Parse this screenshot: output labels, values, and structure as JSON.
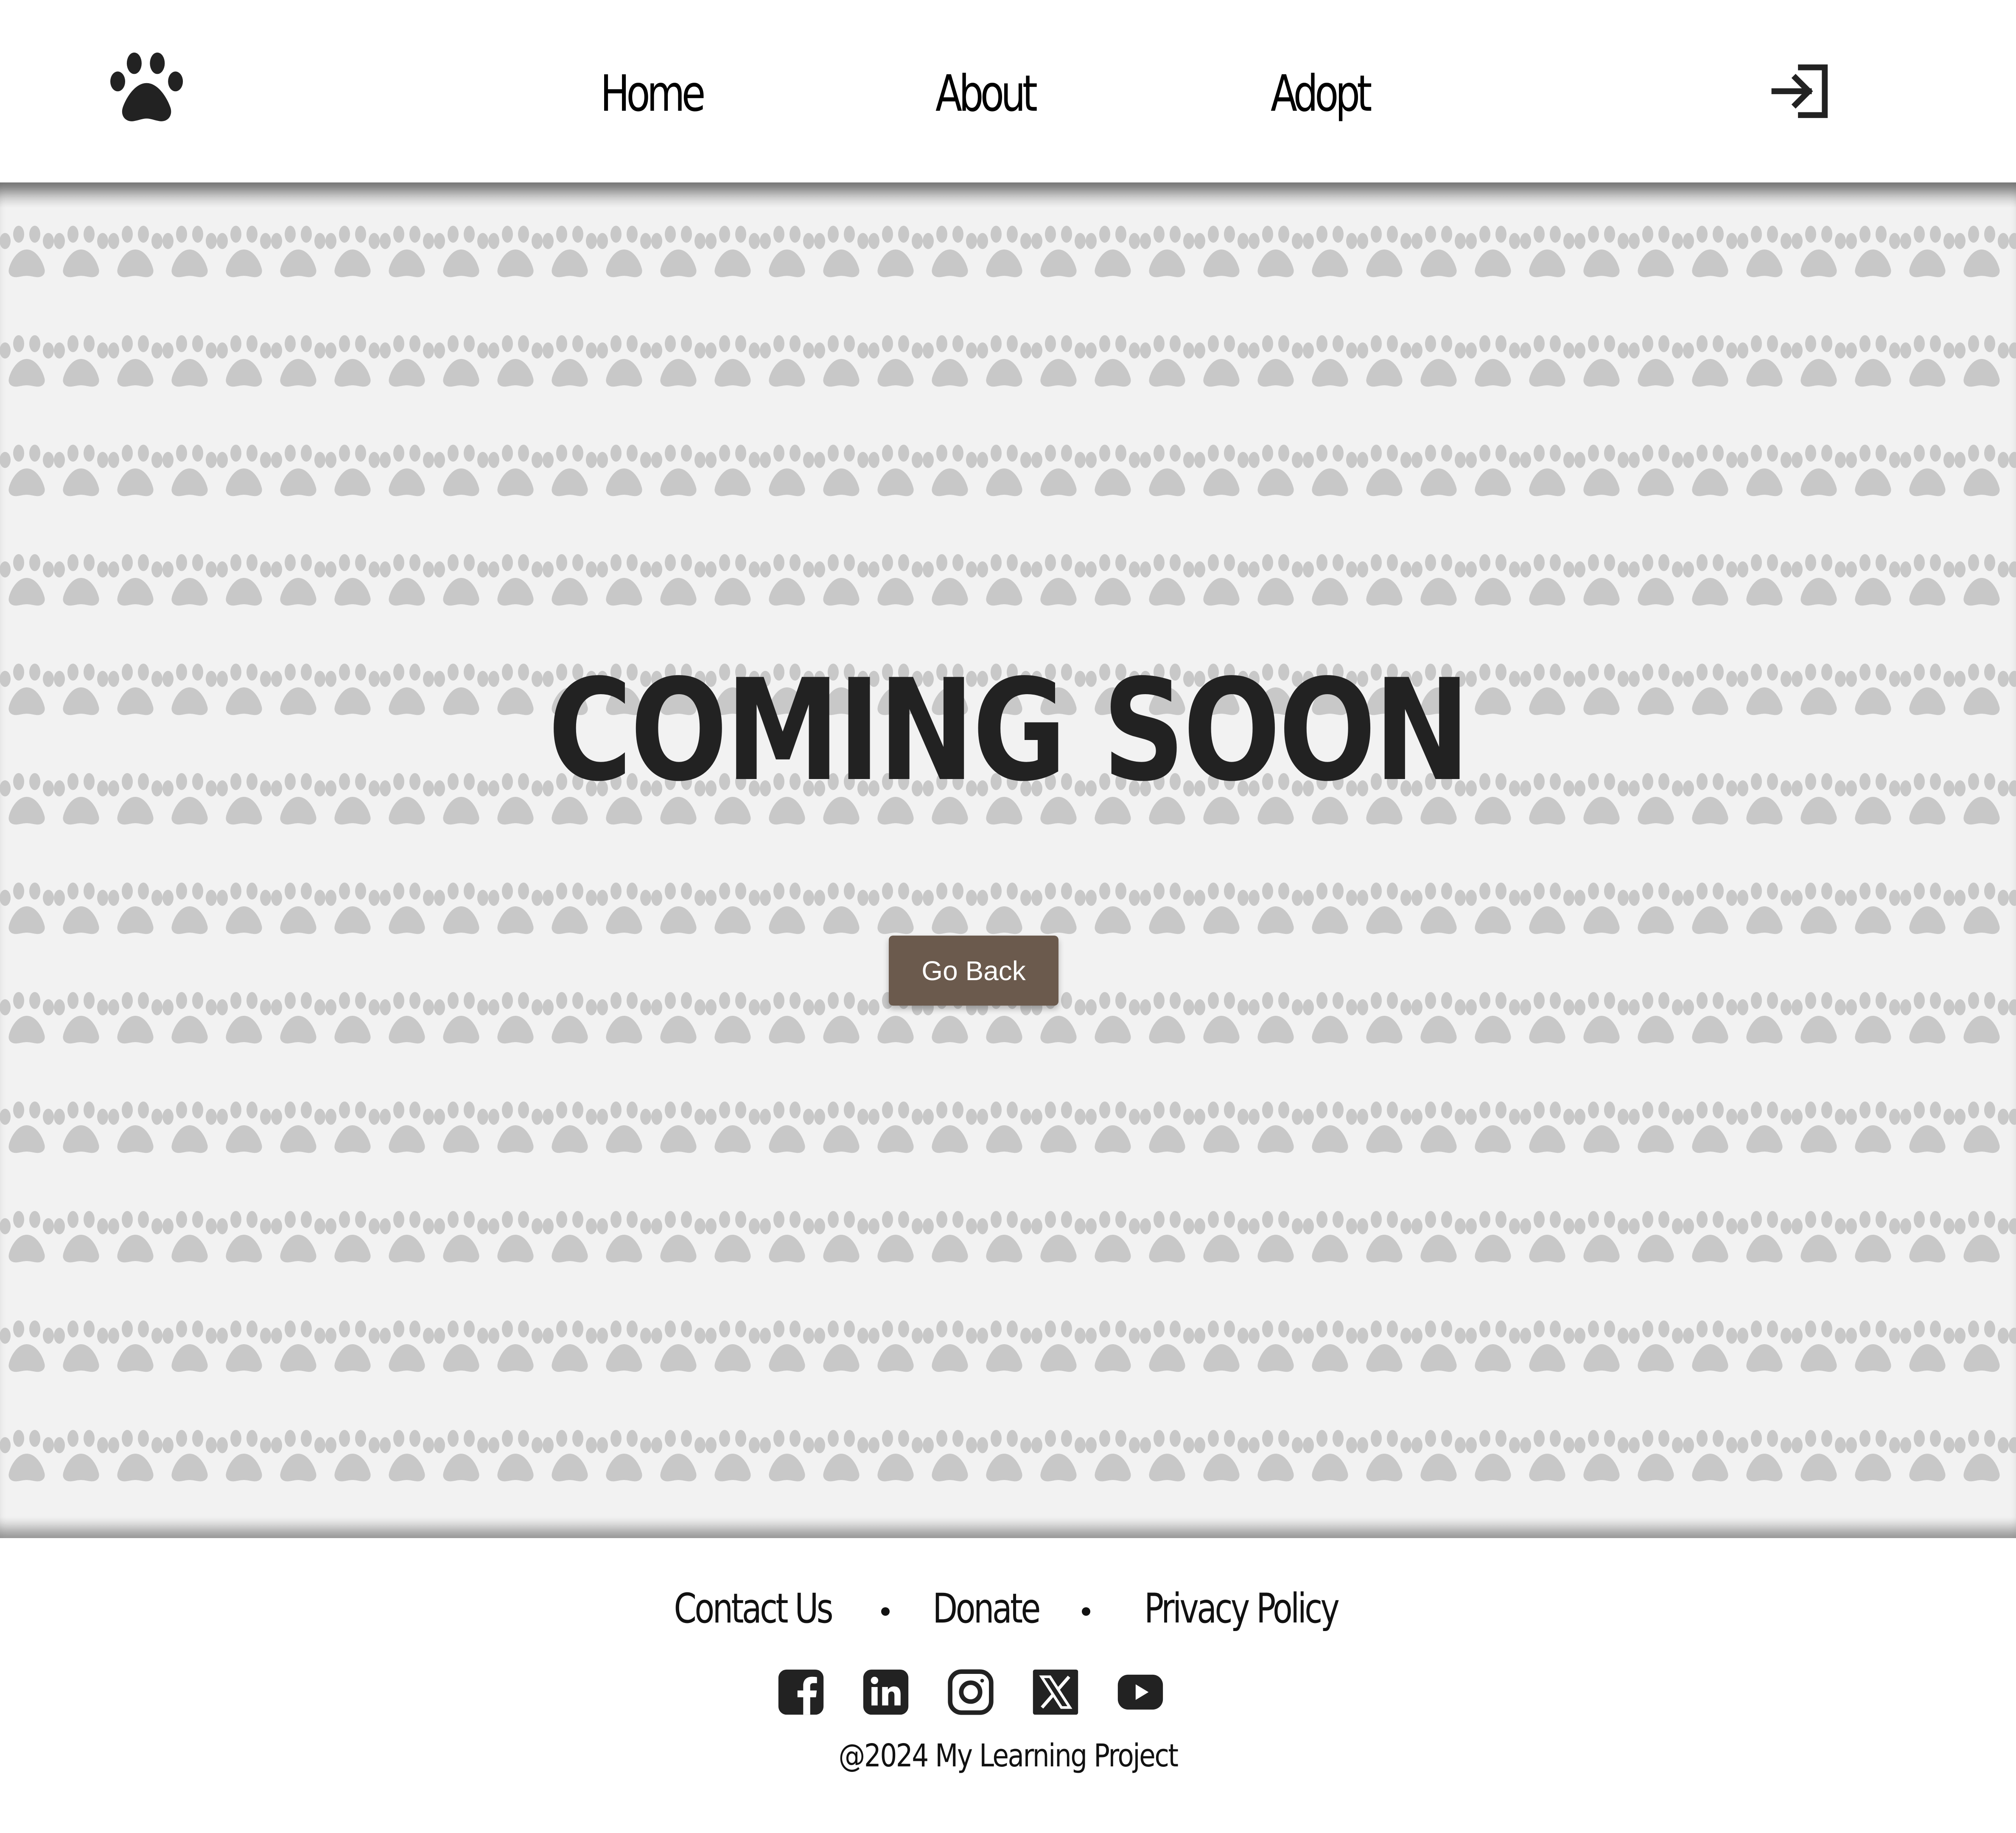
{
  "header": {
    "logo_icon": "paw-icon",
    "nav": [
      {
        "label": "Home"
      },
      {
        "label": "About"
      },
      {
        "label": "Adopt"
      }
    ],
    "login_icon": "login-icon"
  },
  "hero": {
    "headline": "COMING SOON",
    "button_label": "Go Back",
    "background_pattern": "paw-print-icon",
    "colors": {
      "button": "#6b5a4d",
      "pattern": "#c8c8c8",
      "background": "#f2f2f2"
    }
  },
  "footer": {
    "links": [
      {
        "label": "Contact Us"
      },
      {
        "label": "Donate"
      },
      {
        "label": "Privacy Policy"
      }
    ],
    "socials": [
      {
        "icon": "facebook-icon"
      },
      {
        "icon": "linkedin-icon"
      },
      {
        "icon": "instagram-icon"
      },
      {
        "icon": "x-icon"
      },
      {
        "icon": "youtube-icon"
      }
    ],
    "copyright": "@2024 My Learning Project"
  }
}
